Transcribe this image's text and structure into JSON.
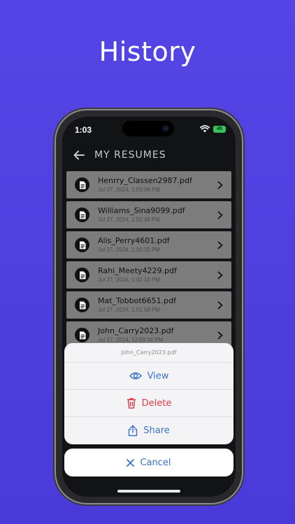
{
  "headline": "History",
  "status": {
    "time": "1:03",
    "battery": "45"
  },
  "header": {
    "title": "MY RESUMES"
  },
  "files": [
    {
      "name": "Henrry_Classen2987.pdf",
      "date": "Jul 27, 2024, 1:03:08 PM"
    },
    {
      "name": "Williams_Sina9099.pdf",
      "date": "Jul 27, 2024, 1:02:49 PM"
    },
    {
      "name": "Alis_Perry4601.pdf",
      "date": "Jul 27, 2024, 1:02:33 PM"
    },
    {
      "name": "Rahi_Meety4229.pdf",
      "date": "Jul 27, 2024, 1:02:10 PM"
    },
    {
      "name": "Mat_Tobbot6651.pdf",
      "date": "Jul 27, 2024, 1:01:58 PM"
    },
    {
      "name": "John_Carry2023.pdf",
      "date": "Jul 27, 2024, 12:59:34 PM"
    }
  ],
  "action_sheet": {
    "title": "John_Carry2023.pdf",
    "view_label": "View",
    "delete_label": "Delete",
    "share_label": "Share",
    "cancel_label": "Cancel"
  },
  "colors": {
    "background": "#5545e6",
    "accent_blue": "#3a72c8",
    "delete_red": "#e03a4a",
    "row_gray": "#7c7c7c"
  },
  "icons": {
    "back": "arrow-left-icon",
    "file": "document-icon",
    "row_action": "chevron-right-icon",
    "view": "eye-icon",
    "delete": "trash-icon",
    "share": "share-icon",
    "cancel": "close-icon"
  }
}
